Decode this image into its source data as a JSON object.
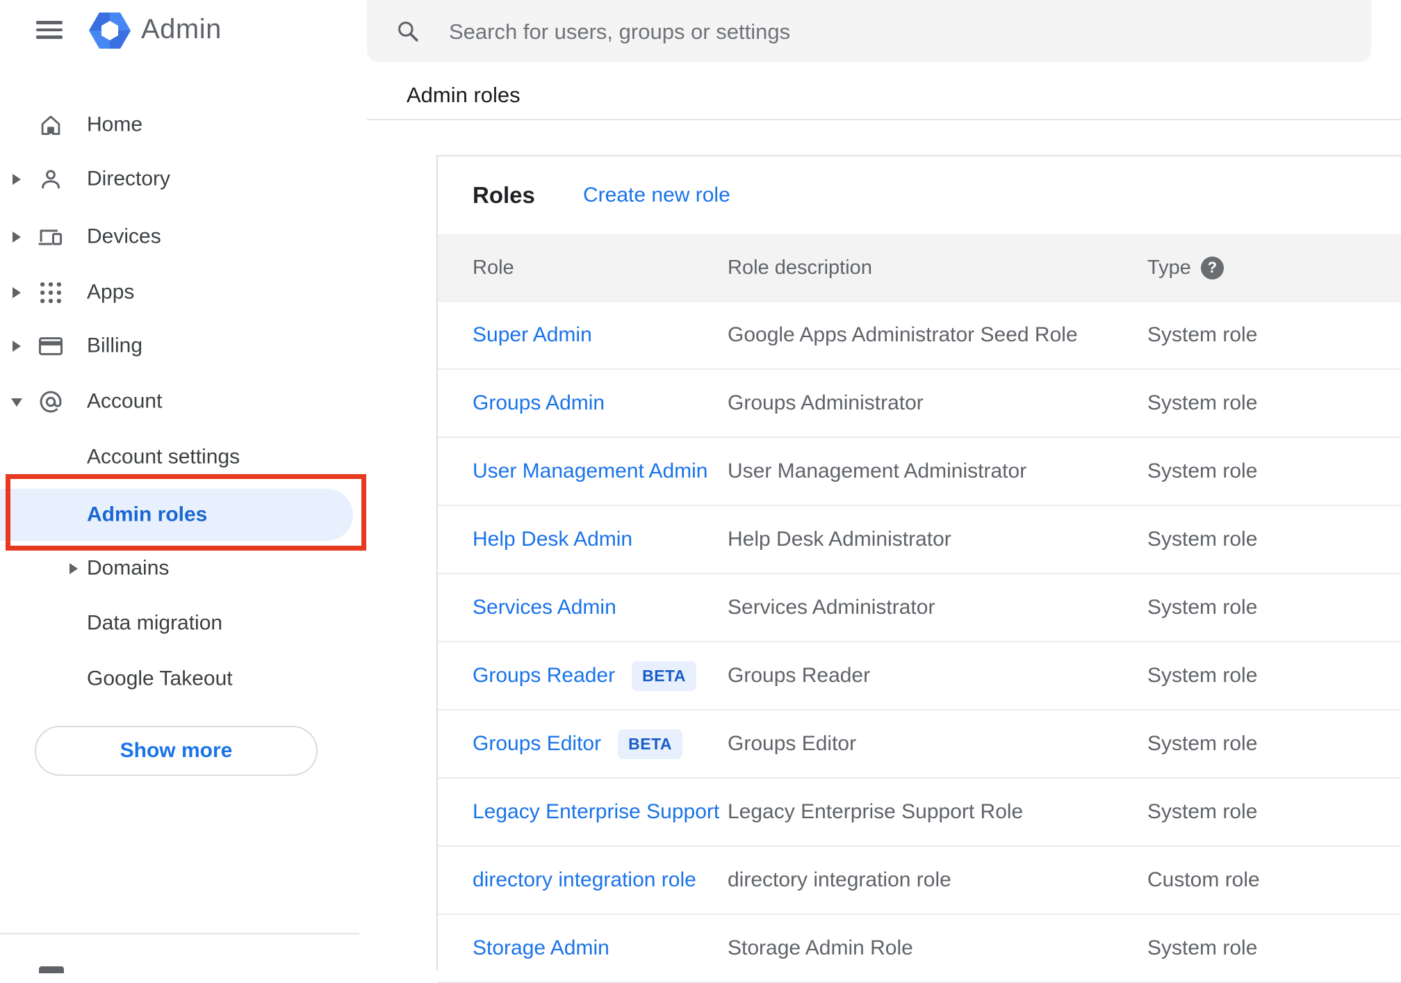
{
  "app": {
    "name": "Admin"
  },
  "search": {
    "placeholder": "Search for users, groups or settings"
  },
  "breadcrumb": "Admin roles",
  "sidebar": {
    "items": [
      {
        "label": "Home",
        "icon": "home",
        "arrow": "none",
        "level": "top",
        "selected": false
      },
      {
        "label": "Directory",
        "icon": "person",
        "arrow": "right",
        "level": "top",
        "selected": false
      },
      {
        "label": "Devices",
        "icon": "devices",
        "arrow": "right",
        "level": "top",
        "selected": false
      },
      {
        "label": "Apps",
        "icon": "apps-grid",
        "arrow": "right",
        "level": "top",
        "selected": false
      },
      {
        "label": "Billing",
        "icon": "credit-card",
        "arrow": "right",
        "level": "top",
        "selected": false
      },
      {
        "label": "Account",
        "icon": "at-sign",
        "arrow": "down",
        "level": "top",
        "selected": false
      },
      {
        "label": "Account settings",
        "icon": null,
        "arrow": "none",
        "level": "sub",
        "selected": false
      },
      {
        "label": "Admin roles",
        "icon": null,
        "arrow": "none",
        "level": "sub",
        "selected": true
      },
      {
        "label": "Domains",
        "icon": null,
        "arrow": "right",
        "level": "sub",
        "selected": false
      },
      {
        "label": "Data migration",
        "icon": null,
        "arrow": "none",
        "level": "sub",
        "selected": false
      },
      {
        "label": "Google Takeout",
        "icon": null,
        "arrow": "none",
        "level": "sub",
        "selected": false
      }
    ],
    "show_more_label": "Show more"
  },
  "main": {
    "card_title": "Roles",
    "create_link_label": "Create new role",
    "table": {
      "columns": [
        "Role",
        "Role description",
        "Type"
      ],
      "beta_label": "BETA",
      "help_glyph": "?",
      "rows": [
        {
          "role": "Super Admin",
          "beta": false,
          "description": "Google Apps Administrator Seed Role",
          "type": "System role"
        },
        {
          "role": "Groups Admin",
          "beta": false,
          "description": "Groups Administrator",
          "type": "System role"
        },
        {
          "role": "User Management Admin",
          "beta": false,
          "description": "User Management Administrator",
          "type": "System role"
        },
        {
          "role": "Help Desk Admin",
          "beta": false,
          "description": "Help Desk Administrator",
          "type": "System role"
        },
        {
          "role": "Services Admin",
          "beta": false,
          "description": "Services Administrator",
          "type": "System role"
        },
        {
          "role": "Groups Reader",
          "beta": true,
          "description": "Groups Reader",
          "type": "System role"
        },
        {
          "role": "Groups Editor",
          "beta": true,
          "description": "Groups Editor",
          "type": "System role"
        },
        {
          "role": "Legacy Enterprise Support",
          "beta": false,
          "description": "Legacy Enterprise Support Role",
          "type": "System role"
        },
        {
          "role": "directory integration role",
          "beta": false,
          "description": "directory integration role",
          "type": "Custom role"
        },
        {
          "role": "Storage Admin",
          "beta": false,
          "description": "Storage Admin Role",
          "type": "System role"
        }
      ]
    }
  },
  "annotation": {
    "shape": "rectangle",
    "around": "Admin roles sidebar item",
    "color": "#e6391f"
  },
  "colors": {
    "link_blue": "#1a73e8",
    "selected_blue": "#1967d2",
    "selected_bg": "#e8f0fe",
    "annotation_red": "#e6391f",
    "icon_gray": "#5f6368",
    "header_row_bg": "#f3f3f3",
    "search_bar_bg": "#f4f4f5"
  }
}
